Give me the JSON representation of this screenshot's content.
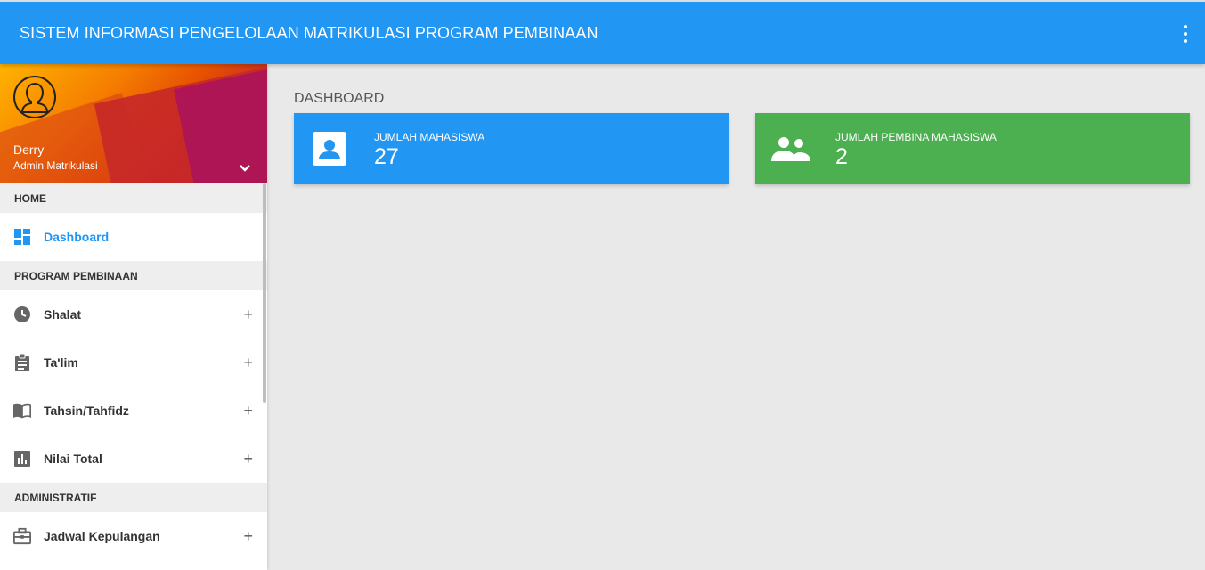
{
  "topbar": {
    "title": "SISTEM INFORMASI PENGELOLAAN MATRIKULASI PROGRAM PEMBINAAN",
    "more_icon": "more-vert-icon"
  },
  "user": {
    "name": "Derry",
    "role": "Admin Matrikulasi"
  },
  "sidebar": {
    "sections": [
      {
        "header": "HOME"
      },
      {
        "header": "PROGRAM PEMBINAAN"
      },
      {
        "header": "ADMINISTRATIF"
      }
    ],
    "items": [
      {
        "label": "Dashboard",
        "icon": "dashboard-icon"
      },
      {
        "label": "Shalat",
        "icon": "clock-icon",
        "expand": "+"
      },
      {
        "label": "Ta'lim",
        "icon": "clipboard-icon",
        "expand": "+"
      },
      {
        "label": "Tahsin/Tahfidz",
        "icon": "book-icon",
        "expand": "+"
      },
      {
        "label": "Nilai Total",
        "icon": "bar-chart-icon",
        "expand": "+"
      },
      {
        "label": "Jadwal Kepulangan",
        "icon": "briefcase-icon",
        "expand": "+"
      }
    ]
  },
  "main": {
    "title": "DASHBOARD",
    "cards": [
      {
        "label": "JUMLAH MAHASISWA",
        "value": "27",
        "icon": "person-box-icon",
        "color": "#2196f3"
      },
      {
        "label": "JUMLAH PEMBINA MAHASISWA",
        "value": "2",
        "icon": "group-icon",
        "color": "#4caf50"
      }
    ]
  },
  "colors": {
    "primary": "#2196f3",
    "success": "#4caf50"
  }
}
